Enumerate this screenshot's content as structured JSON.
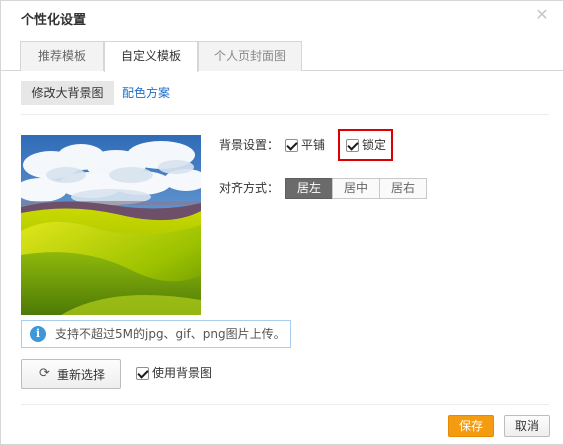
{
  "dialog": {
    "title": "个性化设置",
    "close_icon": "close-icon"
  },
  "tabs": [
    {
      "label": "推荐模板",
      "active": false
    },
    {
      "label": "自定义模板",
      "active": true
    },
    {
      "label": "个人页封面图",
      "active": false
    }
  ],
  "subnav": {
    "active_label": "修改大背景图",
    "link_label": "配色方案"
  },
  "settings": {
    "background_label": "背景设置：",
    "tile_label": "平铺",
    "tile_checked": true,
    "lock_label": "锁定",
    "lock_checked": true,
    "align_label": "对齐方式：",
    "align_options": [
      "居左",
      "居中",
      "居右"
    ],
    "align_selected": "居左"
  },
  "upload": {
    "hint": "支持不超过5M的jpg、gif、png图片上传。",
    "reselect_label": "重新选择",
    "use_background_label": "使用背景图",
    "use_background_checked": true
  },
  "footer": {
    "save_label": "保存",
    "cancel_label": "取消"
  },
  "colors": {
    "save_button": "#f39c12",
    "highlight_border": "#dc0000",
    "link": "#1e6ec8",
    "info_icon": "#3f97d8"
  }
}
